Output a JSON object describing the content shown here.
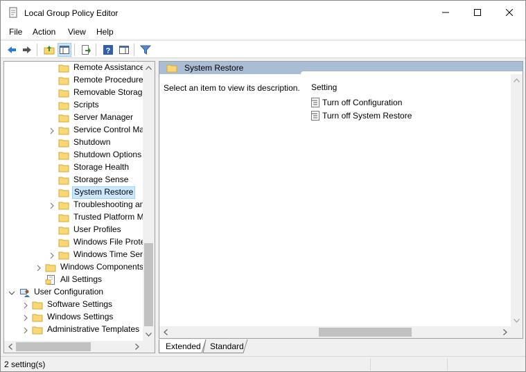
{
  "window": {
    "title": "Local Group Policy Editor"
  },
  "menu": {
    "file": "File",
    "action": "Action",
    "view": "View",
    "help": "Help"
  },
  "toolbar": {
    "items": [
      "back-arrow-icon",
      "forward-arrow-icon",
      "up-folder-icon",
      "show-hide-tree-icon",
      "export-list-icon",
      "help-icon",
      "show-hide-action-pane-icon",
      "filter-icon"
    ]
  },
  "tree": {
    "items": [
      {
        "label": "Remote Assistance"
      },
      {
        "label": "Remote Procedure"
      },
      {
        "label": "Removable Storage"
      },
      {
        "label": "Scripts"
      },
      {
        "label": "Server Manager"
      },
      {
        "label": "Service Control Ma"
      },
      {
        "label": "Shutdown"
      },
      {
        "label": "Shutdown Options"
      },
      {
        "label": "Storage Health"
      },
      {
        "label": "Storage Sense"
      },
      {
        "label": "System Restore"
      },
      {
        "label": "Troubleshooting an"
      },
      {
        "label": "Trusted Platform M"
      },
      {
        "label": "User Profiles"
      },
      {
        "label": "Windows File Prote"
      },
      {
        "label": "Windows Time Serv"
      },
      {
        "label": "Windows Components"
      },
      {
        "label": "All Settings"
      },
      {
        "label": "User Configuration"
      },
      {
        "label": "Software Settings"
      },
      {
        "label": "Windows Settings"
      },
      {
        "label": "Administrative Templates"
      }
    ]
  },
  "main": {
    "header": "System Restore",
    "description": "Select an item to view its description.",
    "column_header": "Setting",
    "settings": [
      {
        "label": "Turn off Configuration"
      },
      {
        "label": "Turn off System Restore"
      }
    ]
  },
  "tabs": {
    "extended": "Extended",
    "standard": "Standard"
  },
  "status": {
    "text": "2 setting(s)"
  },
  "colors": {
    "header_strip": "#a9bdd4",
    "selection": "#cce8ff",
    "folder": "#f8d775"
  }
}
